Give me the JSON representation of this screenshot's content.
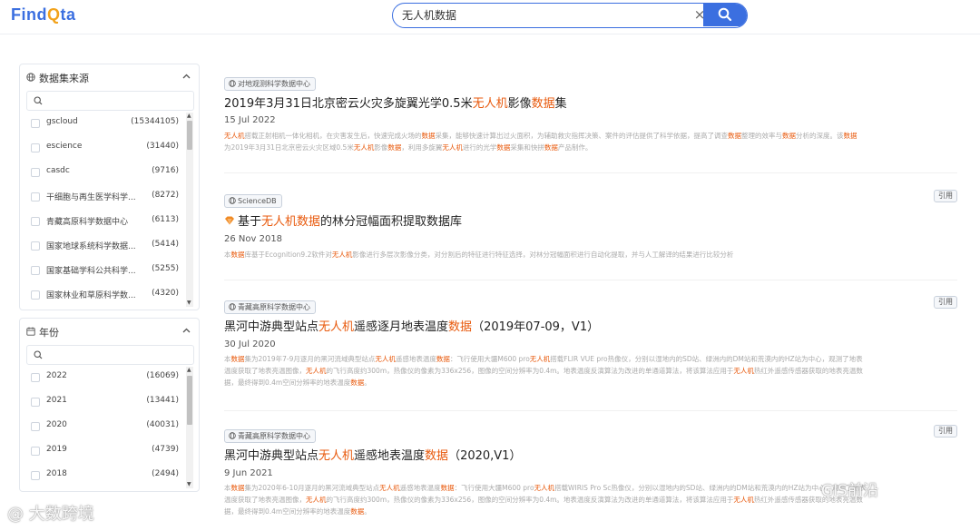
{
  "app": {
    "logo_pre": "Find",
    "logo_mid": "Q",
    "logo_post": "ta"
  },
  "search": {
    "value": "无人机数据",
    "clear_label": "×"
  },
  "sources_panel": {
    "title": "数据集来源",
    "items": [
      {
        "name": "gscloud",
        "count": "(15344105)"
      },
      {
        "name": "escience",
        "count": "(31440)"
      },
      {
        "name": "casdc",
        "count": "(9716)"
      },
      {
        "name": "干细胞与再生医学科学...",
        "count": "(8272)"
      },
      {
        "name": "青藏高原科学数据中心",
        "count": "(6113)"
      },
      {
        "name": "国家地球系统科学数据...",
        "count": "(5414)"
      },
      {
        "name": "国家基础学科公共科学...",
        "count": "(5255)"
      },
      {
        "name": "国家林业和草原科学数...",
        "count": "(4320)"
      }
    ]
  },
  "year_panel": {
    "title": "年份",
    "items": [
      {
        "name": "2022",
        "count": "(16069)"
      },
      {
        "name": "2021",
        "count": "(13441)"
      },
      {
        "name": "2020",
        "count": "(40031)"
      },
      {
        "name": "2019",
        "count": "(4739)"
      },
      {
        "name": "2018",
        "count": "(2494)"
      }
    ]
  },
  "results": [
    {
      "source": "对地观测科学数据中心",
      "title_parts": [
        "2019年3月31日北京密云火灾多旋翼光学0.5米",
        "无人机",
        "影像",
        "数据",
        "集"
      ],
      "date": "15 Jul 2022",
      "desc_lines": [
        "无人机搭载正射相机一体化相机，在灾害发生后，快速完成火场的数据采集，能够快速计算出过火面积，为辅助救灾指挥决策、案件的评估提供了科学依据，提高了调查数据整理的效率与数据分析的深度。该数据",
        "为2019年3月31日北京密云火灾区域0.5米无人机影像数据，利用多旋翼无人机进行的光学数据采集和快拼数据产品制作。"
      ],
      "cite": ""
    },
    {
      "source": "ScienceDB",
      "title_parts": [
        "基于",
        "无人机数据",
        "的林分冠幅面积提取数据库"
      ],
      "date": "26 Nov 2018",
      "desc_lines": [
        "本数据库基于Ecognition9.2软件对无人机影像进行多层次影像分类，对分割后的特征进行特征选择，对林分冠幅面积进行自动化提取，并与人工解译的结果进行比较分析"
      ],
      "cite": "引用"
    },
    {
      "source": "青藏高原科学数据中心",
      "title_parts": [
        "黑河中游典型站点",
        "无人机",
        "遥感逐月地表温度",
        "数据",
        "（2019年07-09，V1）"
      ],
      "date": "30 Jul 2020",
      "desc_lines": [
        "本数据集为2019年7-9月逐月的黑河流域典型站点无人机遥感地表温度数据：飞行使用大疆M600 pro无人机搭载FLIR VUE pro热像仪，分别以湿地内的SD站、绿洲内的DM站和荒漠内的HZ站为中心，观测了地表",
        "温度获取了地表亮温图像，无人机的飞行高度约300m，热像仪的像素为336x256，图像的空间分辨率为0.4m。地表温度反演算法为改进的单通道算法，将该算法应用于无人机热红外遥感传感器获取的地表亮温数",
        "据，最终得到0.4m空间分辨率的地表温度数据。"
      ],
      "cite": "引用"
    },
    {
      "source": "青藏高原科学数据中心",
      "title_parts": [
        "黑河中游典型站点",
        "无人机",
        "遥感地表温度",
        "数据",
        "（2020,V1）"
      ],
      "date": "9 Jun 2021",
      "desc_lines": [
        "本数据集为2020年6-10月逐月的黑河流域典型站点无人机遥感地表温度数据：飞行使用大疆M600 pro无人机搭载WIRIS Pro Sc热像仪，分别以湿地内的SD站、绿洲内的DM站和荒漠内的HZ站为中心，观测了地表",
        "温度获取了地表亮温图像，无人机的飞行高度约300m，热像仪的像素为336x256，图像的空间分辨率为0.4m。地表温度反演算法为改进的单通道算法，将该算法应用于无人机热红外遥感传感器获取的地表亮温数",
        "据，最终得到0.4m空间分辨率的地表温度数据。"
      ],
      "cite": "引用"
    }
  ],
  "watermarks": {
    "left": "@ 大数跨境",
    "right": "GIS前沿"
  },
  "colors": {
    "brand": "#3b6fe0",
    "highlight": "#e8590c"
  },
  "icons": [
    "search-icon",
    "clear-icon",
    "globe-icon",
    "calendar-icon",
    "chevron-up-icon",
    "diamond-icon"
  ]
}
